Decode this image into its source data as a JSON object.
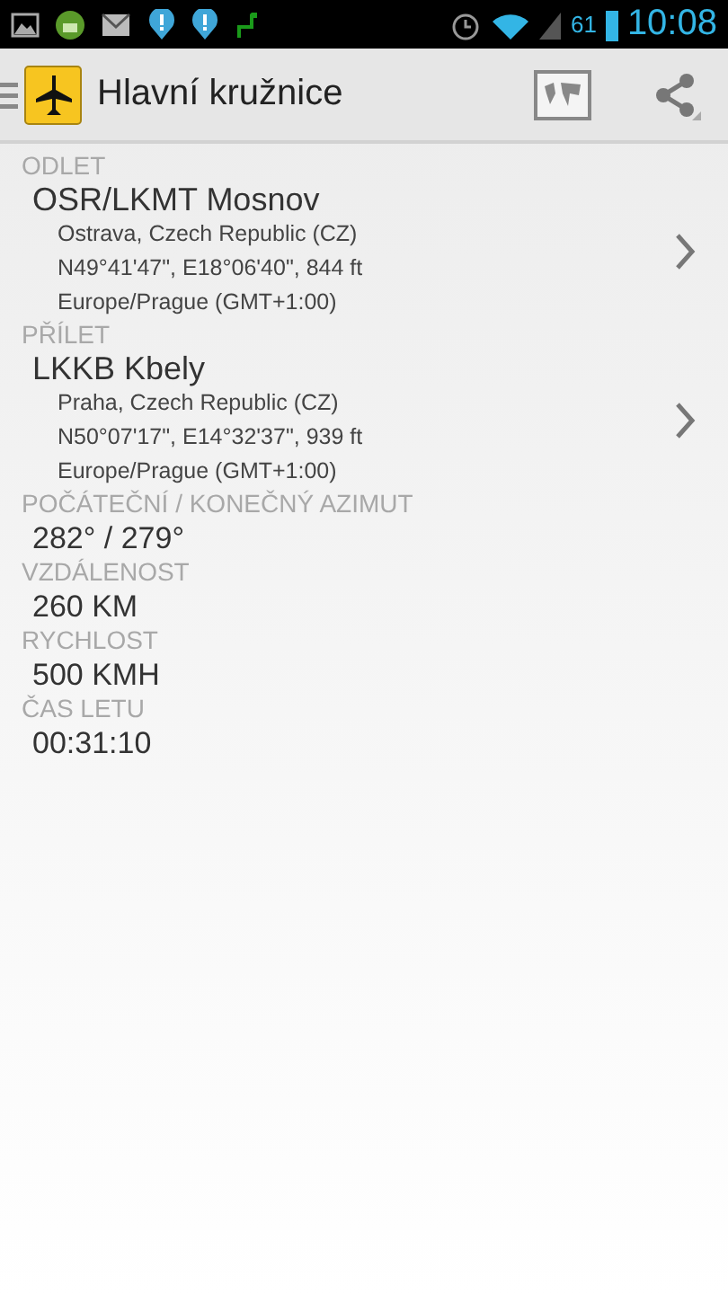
{
  "status_bar": {
    "battery": "61",
    "time": "10:08"
  },
  "action_bar": {
    "title": "Hlavní kružnice"
  },
  "sections": [
    {
      "kind": "airport",
      "label": "ODLET",
      "name": "OSR/LKMT Mosnov",
      "details": [
        "Ostrava, Czech Republic (CZ)",
        "N49°41'47\", E18°06'40\", 844 ft",
        "Europe/Prague (GMT+1:00)"
      ]
    },
    {
      "kind": "airport",
      "label": "PŘÍLET",
      "name": "LKKB Kbely",
      "details": [
        "Praha, Czech Republic (CZ)",
        "N50°07'17\", E14°32'37\", 939 ft",
        "Europe/Prague (GMT+1:00)"
      ]
    },
    {
      "kind": "value",
      "label": "POČÁTEČNÍ / KONEČNÝ AZIMUT",
      "value": "282° / 279°"
    },
    {
      "kind": "value",
      "label": "VZDÁLENOST",
      "value": "260 KM"
    },
    {
      "kind": "value",
      "label": "RYCHLOST",
      "value": "500 KMH"
    },
    {
      "kind": "value",
      "label": "ČAS LETU",
      "value": "00:31:10"
    }
  ]
}
